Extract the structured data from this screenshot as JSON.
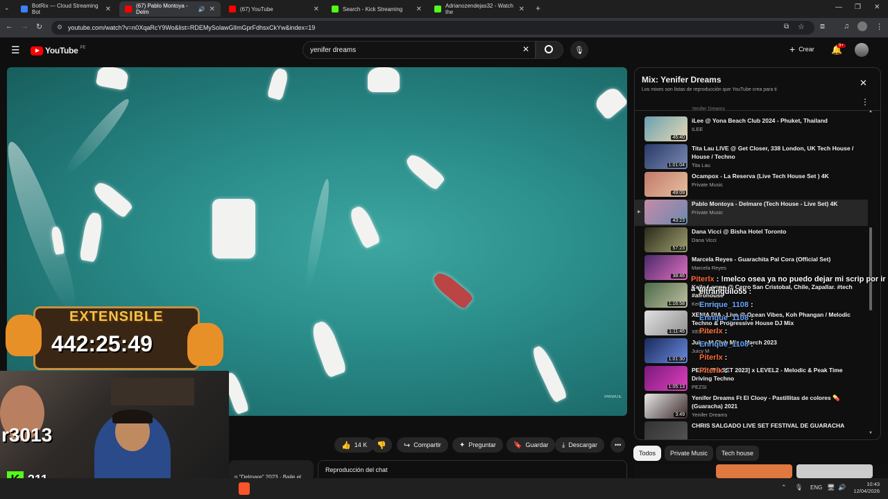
{
  "browser": {
    "tabs": [
      {
        "title": "BotRix — Cloud Streaming Bot",
        "color": "#3b82f6"
      },
      {
        "title": "(67) Pablo Montoya - Delm",
        "color": "#ff0000"
      },
      {
        "title": "(67) YouTube",
        "color": "#ff0000"
      },
      {
        "title": "Search - Kick Streaming",
        "color": "#53fc18"
      },
      {
        "title": "Adrianozendejas32 - Watch the",
        "color": "#53fc18"
      }
    ],
    "url": "youtube.com/watch?v=n0XqaRcY9Wo&list=RDEMySolawGlImGprFdhsxCkYw&index=19"
  },
  "youtube": {
    "logo_text": "YouTube",
    "region": "PE",
    "search_value": "yenifer dreams",
    "create_label": "Crear",
    "notif_count": "9+"
  },
  "video": {
    "watermark": "PRIVATE"
  },
  "actions": {
    "likes": "14 K",
    "share": "Compartir",
    "ask": "Preguntar",
    "save": "Guardar",
    "download": "Descargar"
  },
  "below": {
    "desc_fragment": "n \"Delmare\" 2023 · Baile el",
    "chat_replay": "Reproducción del chat"
  },
  "playlist": {
    "title": "Mix: Yenifer Dreams",
    "subtitle": "Los mixes son listas de reproducción que YouTube crea para ti",
    "partial_top": "Yenifer Dreams",
    "items": [
      {
        "title": "iLee @ Yona Beach Club 2024 - Phuket, Thailand",
        "channel": "ILEE",
        "duration": "45:40",
        "c1": "#6aa0b0",
        "c2": "#e8d9b5"
      },
      {
        "title": "Tita Lau LIVE @ Get Closer, 338 London, UK Tech House / House / Techno",
        "channel": "Tita Lau",
        "duration": "1:01:04",
        "c1": "#2a3a6a",
        "c2": "#7a8ab0"
      },
      {
        "title": "Ocampox - La Reserva (Live Tech House Set ) 4K",
        "channel": "Private Music",
        "duration": "49:09",
        "c1": "#c07a6a",
        "c2": "#e8c0a0"
      },
      {
        "title": "Pablo Montoya - Delmare (Tech House - Live Set) 4K",
        "channel": "Private Music",
        "duration": "43:23",
        "c1": "#c88aa8",
        "c2": "#6a8ab0"
      },
      {
        "title": "Dana Vicci @ Bisha Hotel Toronto",
        "channel": "Dana Vicci",
        "duration": "57:23",
        "c1": "#2a2a1a",
        "c2": "#a0a070"
      },
      {
        "title": "Marcela Reyes - Guarachita Pal Cora (Official Set)",
        "channel": "Marcela Reyes",
        "duration": "38:46",
        "c1": "#4a2a6a",
        "c2": "#e070c0"
      },
      {
        "title": "Keila Lamas @ Cerro San Cristobal, Chile, Zapallar. #tech #afrohouse",
        "channel": "Keila Lamas",
        "duration": "1:16:58",
        "c1": "#4a6a4a",
        "c2": "#c0c0a0"
      },
      {
        "title": "XENIA DIA - Live @ Ocean Vibes, Koh Phangan / Melodic Techno & Progressive House DJ Mix",
        "channel": "XENIA DIA",
        "duration": "1:11:46",
        "c1": "#e0e0e0",
        "c2": "#909090"
      },
      {
        "title": "Juicy M Club Mix - March 2023",
        "channel": "Juicy M",
        "duration": "1:01:30",
        "c1": "#1a2a5a",
        "c2": "#6a8ae0"
      },
      {
        "title": "PEZSI [DJ-SET 2023] x LEVEL2 - Melodic & Peak Time Driving Techno",
        "channel": "PEZSI",
        "duration": "1:05:13",
        "c1": "#7a1a7a",
        "c2": "#e040c0"
      },
      {
        "title": "Yenifer Dreams Ft El Clooy - Pastillitas de colores 💊 (Guaracha) 2021",
        "channel": "Yenifer Dreams",
        "duration": "3:49",
        "c1": "#e8e8e8",
        "c2": "#3a2a2a"
      },
      {
        "title": "CHRIS SALGADO LIVE SET FESTIVAL DE GUARACHA",
        "channel": "",
        "duration": "",
        "c1": "#333",
        "c2": "#555"
      }
    ]
  },
  "chips": [
    "Todos",
    "Private Music",
    "Tech house"
  ],
  "stream_overlay": {
    "label": "EXTENSIBLE",
    "timer": "442:25:49",
    "side_text": "r3013",
    "viewers": "311"
  },
  "chat": [
    {
      "user": "Piterlx",
      "msg": ": !melco osea ya no puedo dejar mi scrip por ir a votar #tu"
    },
    {
      "user": "eltranquilo55",
      "msg": ":"
    },
    {
      "user": "Enrique_1108",
      "msg": ":"
    },
    {
      "user": "Enrique_1108",
      "msg": ":"
    },
    {
      "user": "Piterlx",
      "msg": ":"
    },
    {
      "user": "Enrique_1108",
      "msg": ":"
    },
    {
      "user": "Piterlx",
      "msg": ":"
    },
    {
      "user": "Piterlx",
      "msg": ":"
    }
  ],
  "taskbar": {
    "lang": "ENG",
    "time": "10:43",
    "date": "12/04/2026"
  }
}
